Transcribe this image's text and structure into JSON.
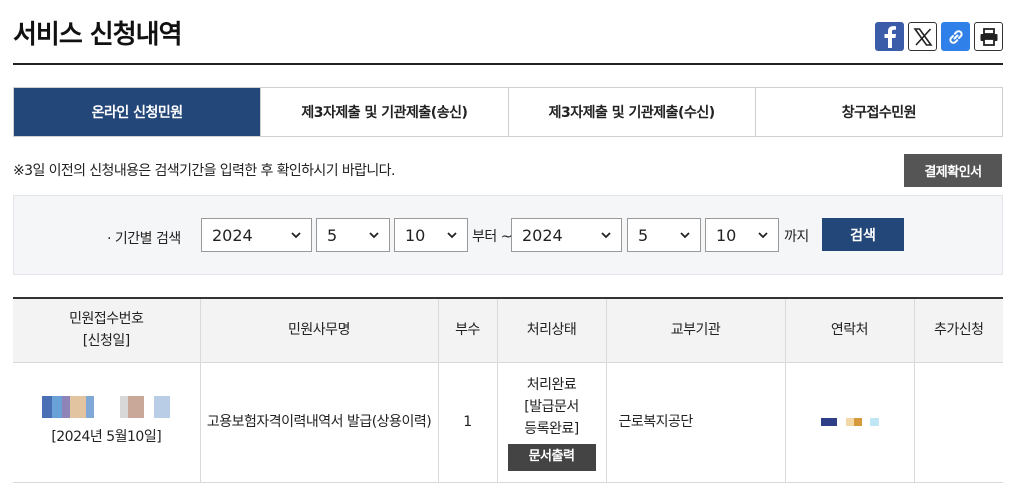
{
  "header": {
    "title": "서비스 신청내역",
    "share_icons": [
      "facebook-icon",
      "x-icon",
      "link-icon",
      "print-icon"
    ]
  },
  "tabs": [
    {
      "label": "온라인 신청민원",
      "active": true
    },
    {
      "label": "제3자제출 및 기관제출(송신)",
      "active": false
    },
    {
      "label": "제3자제출 및 기관제출(수신)",
      "active": false
    },
    {
      "label": "창구접수민원",
      "active": false
    }
  ],
  "notice": "※3일 이전의 신청내용은 검색기간을 입력한 후 확인하시기 바랍니다.",
  "confirm_button": "결제확인서",
  "search": {
    "label": "· 기간별 검색",
    "from_year": "2024",
    "from_month": "5",
    "from_day": "10",
    "from_suffix": "부터 ~",
    "to_year": "2024",
    "to_month": "5",
    "to_day": "10",
    "to_suffix": "까지",
    "button": "검색"
  },
  "table": {
    "headers": {
      "receipt_no": "민원접수번호",
      "receipt_date": "[신청일]",
      "service": "민원사무명",
      "copies": "부수",
      "status": "처리상태",
      "agency": "교부기관",
      "contact": "연락처",
      "extra": "추가신청"
    },
    "rows": [
      {
        "receipt_date": "[2024년 5월10일]",
        "service": "고용보험자격이력내역서 발급(상용이력)",
        "copies": "1",
        "status_1": "처리완료",
        "status_2": "[발급문서",
        "status_3": "등록완료]",
        "print_button": "문서출력",
        "agency": "근로복지공단",
        "extra": ""
      }
    ]
  },
  "colors": {
    "accent": "#24477a",
    "dark_button": "#555555",
    "facebook": "#3b5ca8",
    "link": "#2f80e8"
  }
}
